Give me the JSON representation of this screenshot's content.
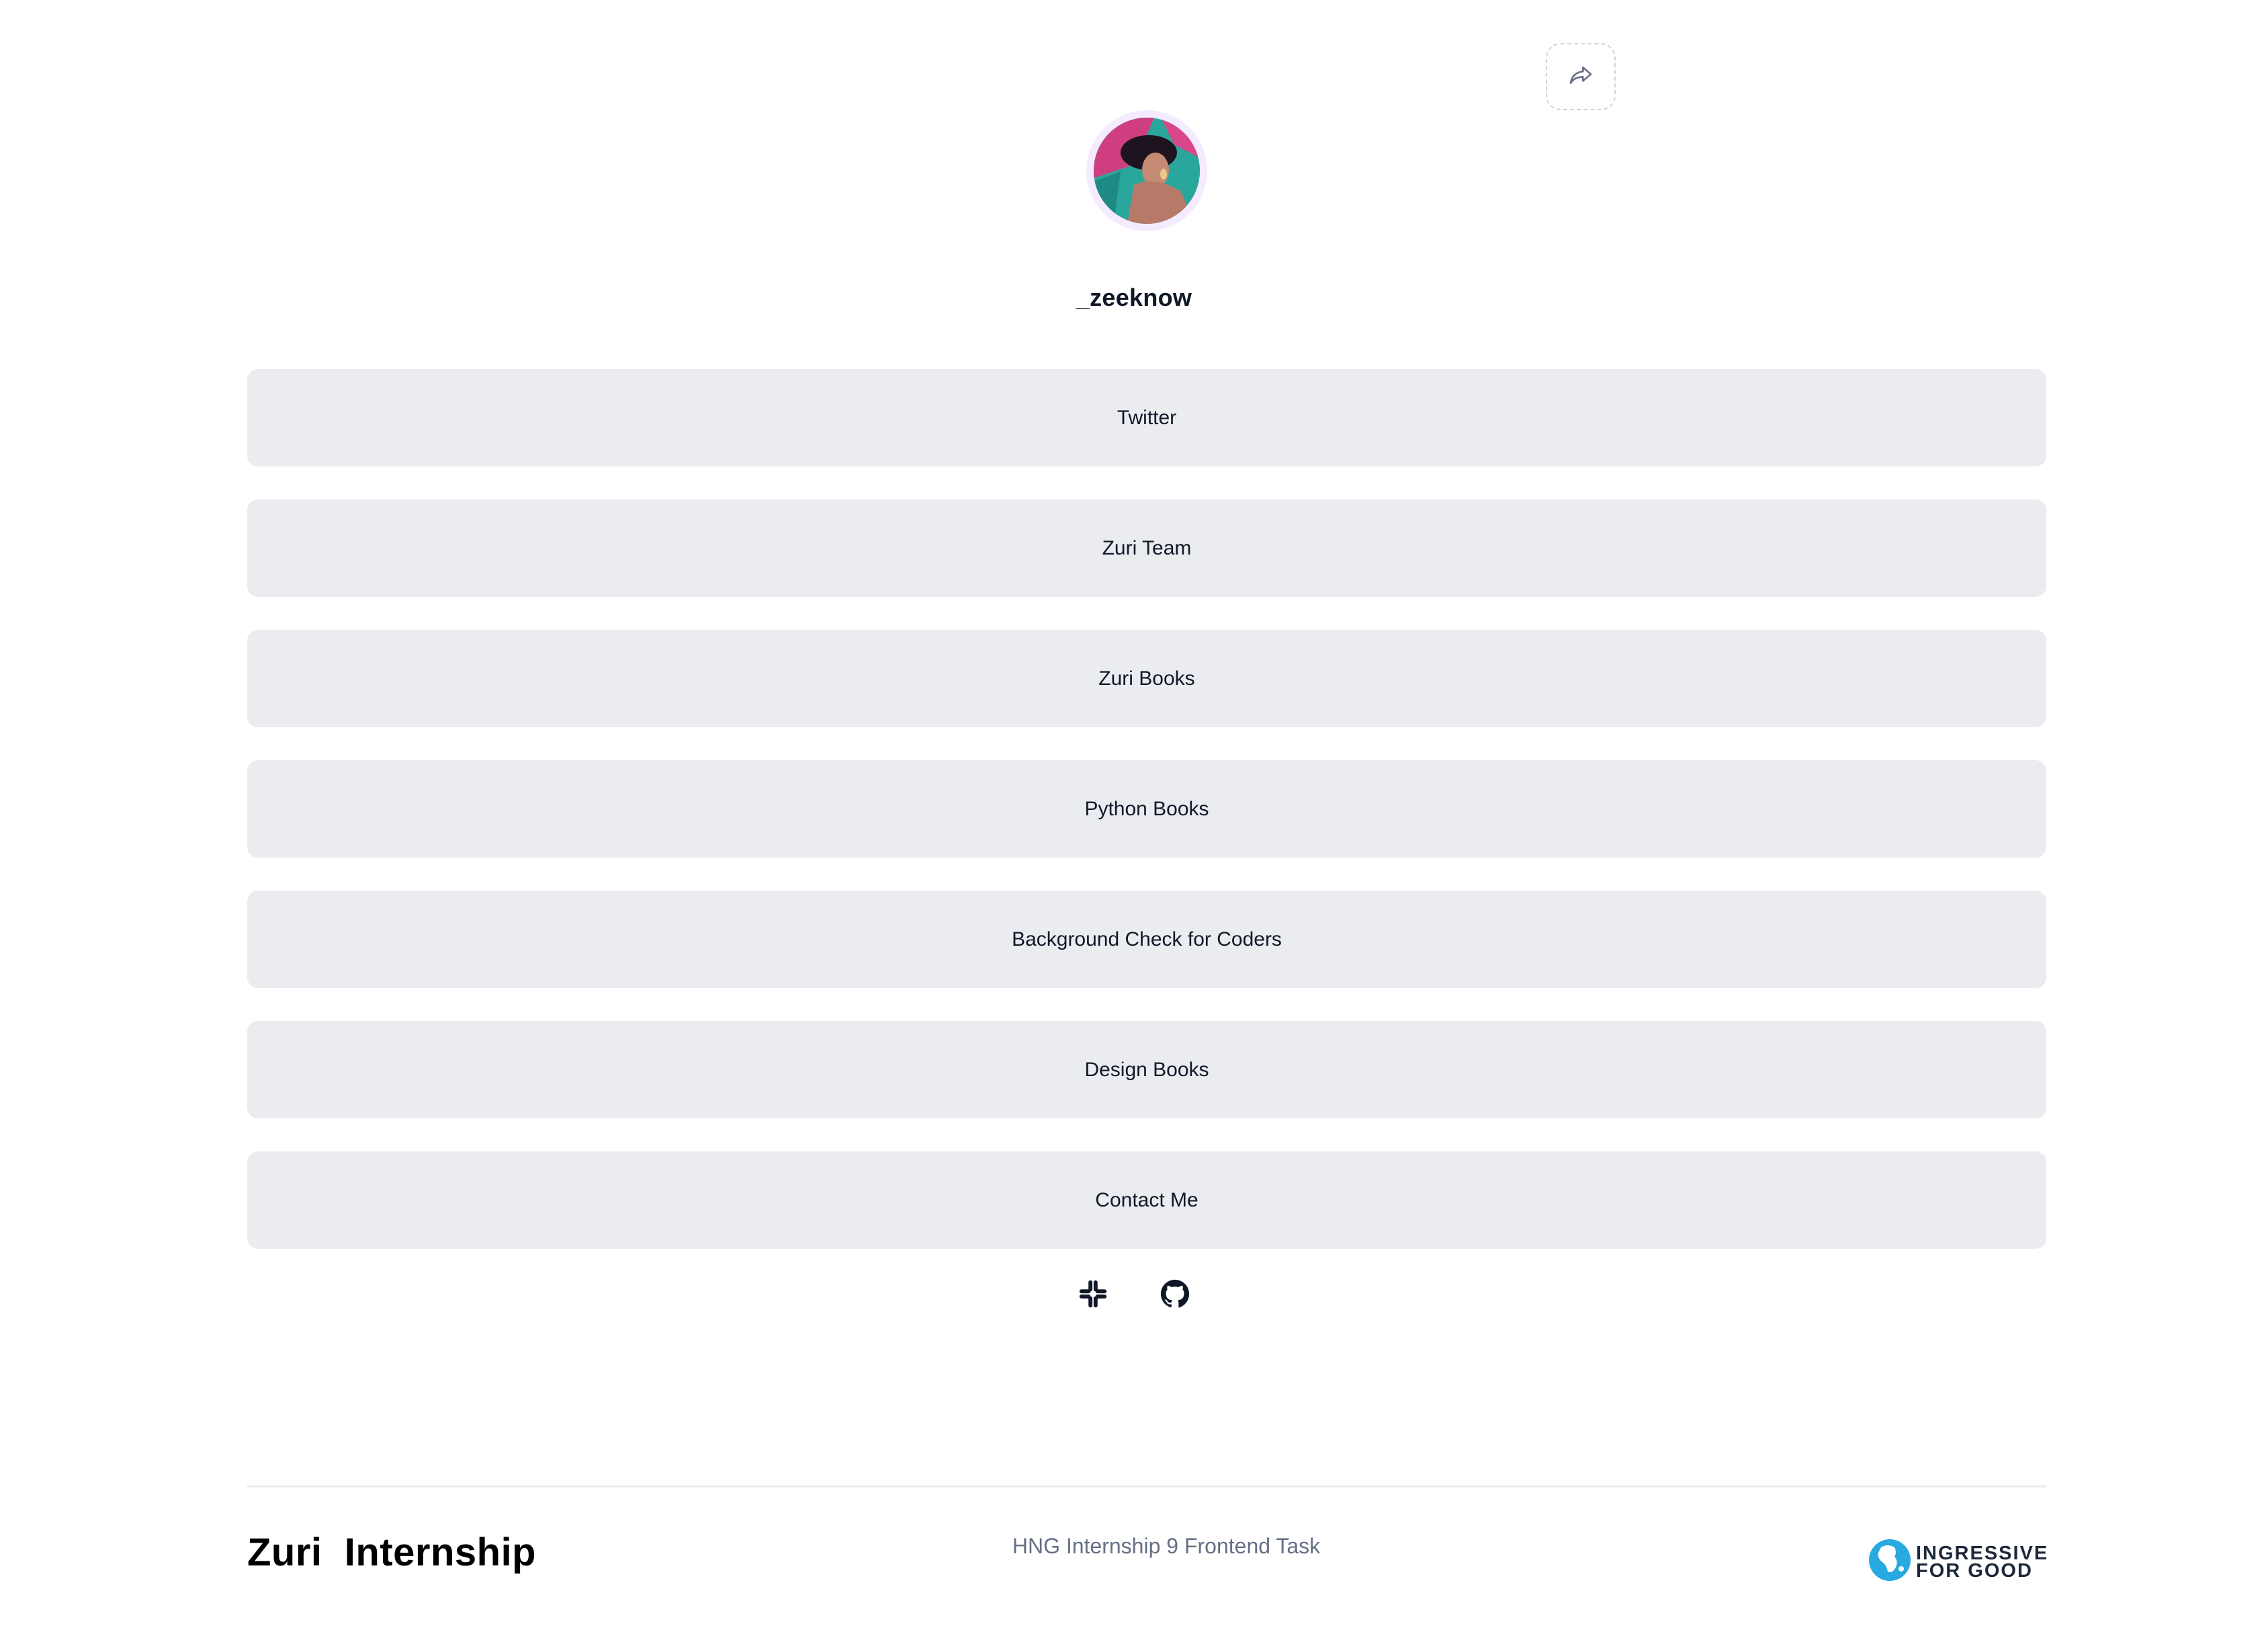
{
  "profile": {
    "username": "_zeeknow"
  },
  "share": {
    "icon": "share-icon"
  },
  "links": [
    {
      "label": "Twitter"
    },
    {
      "label": "Zuri Team"
    },
    {
      "label": "Zuri Books"
    },
    {
      "label": "Python Books"
    },
    {
      "label": "Background Check for Coders"
    },
    {
      "label": "Design Books"
    },
    {
      "label": "Contact Me"
    }
  ],
  "socials": [
    {
      "icon": "slack-icon"
    },
    {
      "icon": "github-icon"
    }
  ],
  "footer": {
    "brand": "Zuri  Internship",
    "center_text": "HNG Internship 9 Frontend Task",
    "partner_line1": "INGRESSIVE",
    "partner_line2": "FOR GOOD"
  },
  "colors": {
    "button_bg": "#eaecf0",
    "text": "#101828",
    "muted": "#667085",
    "avatar_ring": "#f4ebff"
  }
}
